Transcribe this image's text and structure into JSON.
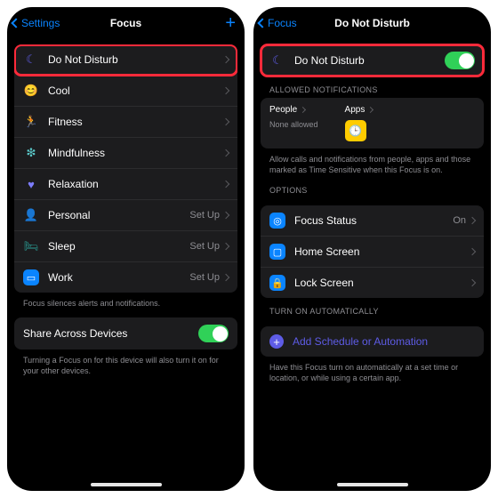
{
  "left": {
    "back": "Settings",
    "title": "Focus",
    "items": [
      {
        "icon": "☾",
        "color": "#5e5ce6",
        "label": "Do Not Disturb",
        "detail": ""
      },
      {
        "icon": "😊",
        "color": "#ff453a",
        "label": "Cool",
        "detail": ""
      },
      {
        "icon": "🏃",
        "color": "#30d158",
        "label": "Fitness",
        "detail": ""
      },
      {
        "icon": "❇",
        "color": "#5ac8c8",
        "label": "Mindfulness",
        "detail": ""
      },
      {
        "icon": "♥",
        "color": "#7d7dff",
        "label": "Relaxation",
        "detail": ""
      },
      {
        "icon": "👤",
        "color": "#bf5af2",
        "label": "Personal",
        "detail": "Set Up"
      },
      {
        "icon": "🛏",
        "color": "#2aa198",
        "label": "Sleep",
        "detail": "Set Up"
      },
      {
        "icon": "📱",
        "color": "#0a84ff",
        "label": "Work",
        "detail": "Set Up"
      }
    ],
    "footer1": "Focus silences alerts and notifications.",
    "share_label": "Share Across Devices",
    "footer2": "Turning a Focus on for this device will also turn it on for your other devices."
  },
  "right": {
    "back": "Focus",
    "title": "Do Not Disturb",
    "dnd_label": "Do Not Disturb",
    "allowed_header": "ALLOWED NOTIFICATIONS",
    "people_label": "People",
    "none_allowed": "None allowed",
    "apps_label": "Apps",
    "allowed_footer": "Allow calls and notifications from people, apps and those marked as Time Sensitive when this Focus is on.",
    "options_header": "OPTIONS",
    "options": [
      {
        "icon": "◎",
        "label": "Focus Status",
        "detail": "On"
      },
      {
        "icon": "▢",
        "label": "Home Screen",
        "detail": ""
      },
      {
        "icon": "🔒",
        "label": "Lock Screen",
        "detail": ""
      }
    ],
    "auto_header": "TURN ON AUTOMATICALLY",
    "add_label": "Add Schedule or Automation",
    "auto_footer": "Have this Focus turn on automatically at a set time or location, or while using a certain app."
  }
}
